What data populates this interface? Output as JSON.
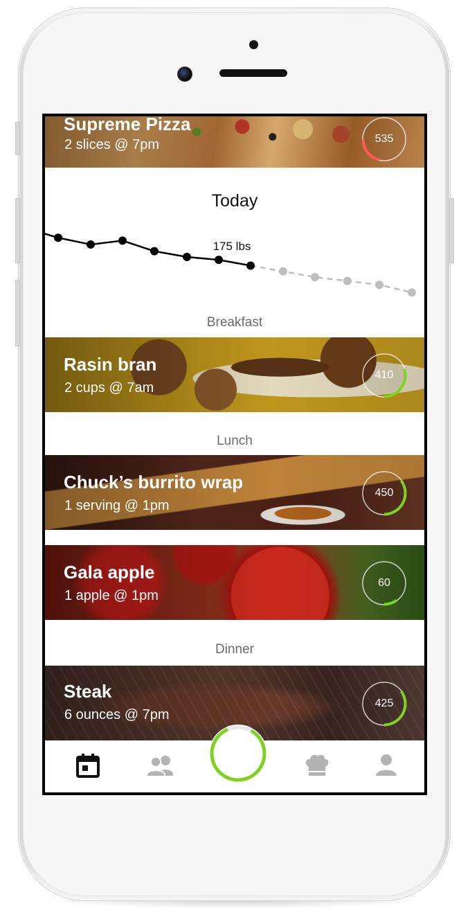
{
  "feed": {
    "top_card": {
      "name": "Supreme Pizza",
      "detail": "2 slices @ 7pm",
      "calories": "535",
      "ring_color": "#ff5a55"
    },
    "today": {
      "title": "Today",
      "weight_label": "175 lbs",
      "chart_data": {
        "type": "line",
        "series": [
          {
            "style": "actual",
            "color": "#000000",
            "values": [
              178.4,
              177.9,
              177.2,
              177.6,
              176.5,
              175.9,
              175.6,
              175.0
            ]
          },
          {
            "style": "projected",
            "color": "#bdbdbd",
            "values": [
              175.0,
              174.4,
              173.8,
              173.4,
              173.0,
              172.2
            ]
          }
        ]
      }
    },
    "sections": [
      {
        "label": "Breakfast",
        "items": [
          {
            "name": "Rasin bran",
            "detail": "2 cups @ 7am",
            "calories": "410",
            "progress": 0.3,
            "ring_color": "#7ed321"
          }
        ]
      },
      {
        "label": "Lunch",
        "items": [
          {
            "name": "Chuck’s burrito wrap",
            "detail": "1 serving @ 1pm",
            "calories": "450",
            "progress": 0.35,
            "ring_color": "#7ed321"
          },
          {
            "name": "Gala apple",
            "detail": "1 apple @ 1pm",
            "calories": "60",
            "progress": 0.1,
            "ring_color": "#7ed321"
          }
        ]
      },
      {
        "label": "Dinner",
        "items": [
          {
            "name": "Steak",
            "detail": "6 ounces @ 7pm",
            "calories": "425",
            "progress": 0.35,
            "ring_color": "#7ed321"
          }
        ]
      }
    ]
  },
  "tabbar": {
    "tabs": [
      {
        "icon": "calendar-icon",
        "active": true
      },
      {
        "icon": "people-icon",
        "active": false
      },
      {
        "icon": "progress-ring-button",
        "active": false,
        "progress": 0.85,
        "color": "#7ed321"
      },
      {
        "icon": "chef-hat-icon",
        "active": false
      },
      {
        "icon": "person-icon",
        "active": false
      }
    ]
  },
  "colors": {
    "accent_green": "#7ed321",
    "accent_red": "#ff5a55",
    "tab_inactive": "#b3b3b3",
    "tab_active": "#111111"
  }
}
